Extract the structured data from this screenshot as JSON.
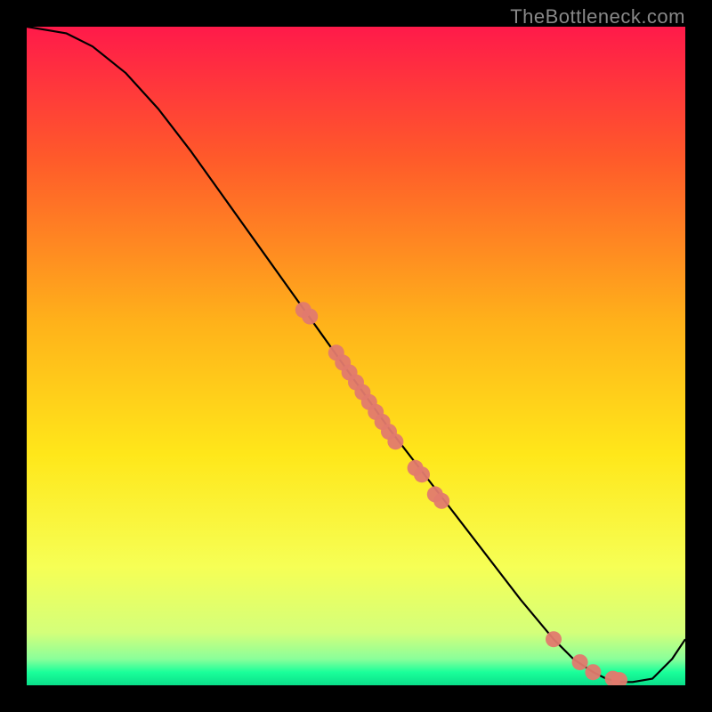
{
  "watermark": "TheBottleneck.com",
  "chart_data": {
    "type": "line",
    "title": "",
    "xlabel": "",
    "ylabel": "",
    "xlim": [
      0,
      100
    ],
    "ylim": [
      0,
      100
    ],
    "grid": false,
    "legend": false,
    "background_gradient": {
      "top": "#ff1a4a",
      "upper_mid": "#ff8c1a",
      "mid": "#ffe71a",
      "lower_mid": "#e6ff4a",
      "bottom_band": "#1aff9a"
    },
    "series": [
      {
        "name": "curve",
        "color": "#000000",
        "x": [
          0,
          3,
          6,
          10,
          15,
          20,
          25,
          30,
          35,
          40,
          45,
          50,
          55,
          60,
          65,
          70,
          75,
          80,
          83,
          86,
          88,
          90,
          92,
          95,
          98,
          100
        ],
        "y": [
          100,
          99.5,
          99,
          97,
          93,
          87.5,
          81,
          74,
          67,
          60,
          53,
          46,
          39,
          32.5,
          26,
          19.5,
          13,
          7,
          4,
          2,
          1,
          0.5,
          0.5,
          1,
          4,
          7
        ]
      }
    ],
    "scatter": [
      {
        "name": "points",
        "color": "#e27a6e",
        "radius": 9,
        "x": [
          42,
          43,
          47,
          48,
          49,
          50,
          51,
          52,
          53,
          54,
          55,
          56,
          59,
          60,
          62,
          63,
          80,
          84,
          86,
          89,
          90
        ],
        "y": [
          57,
          56,
          50.5,
          49,
          47.5,
          46,
          44.5,
          43,
          41.5,
          40,
          38.5,
          37,
          33,
          32,
          29,
          28,
          7,
          3.5,
          2,
          1,
          0.8
        ]
      }
    ]
  }
}
